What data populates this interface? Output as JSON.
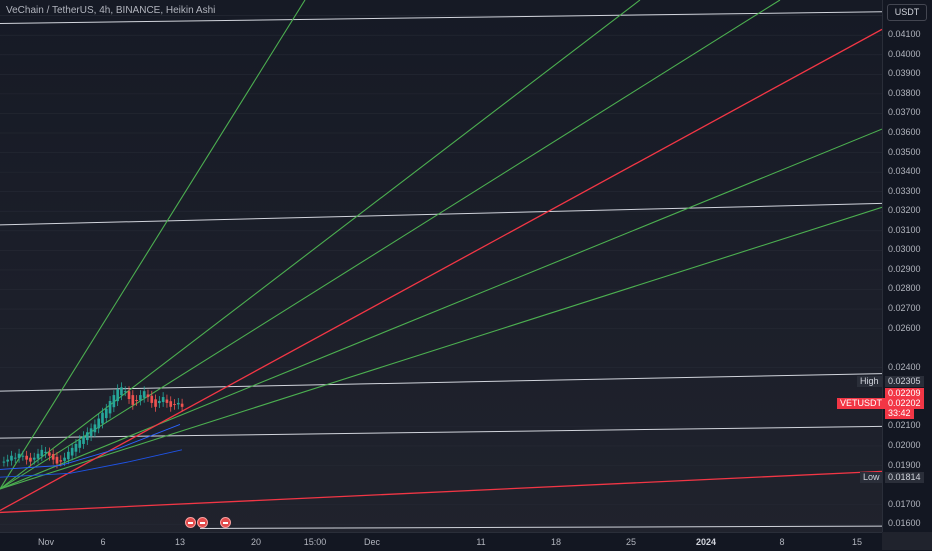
{
  "header": {
    "title": "VeChain / TetherUS, 4h, BINANCE, Heikin Ashi"
  },
  "price_axis": {
    "currency_label": "USDT",
    "tick_labels": [
      "0.04200",
      "0.04100",
      "0.04000",
      "0.03900",
      "0.03800",
      "0.03700",
      "0.03600",
      "0.03500",
      "0.03400",
      "0.03300",
      "0.03200",
      "0.03100",
      "0.03000",
      "0.02900",
      "0.02800",
      "0.02700",
      "0.02600",
      "0.02400",
      "0.02100",
      "0.02000",
      "0.01900",
      "0.01700",
      "0.01600"
    ]
  },
  "price_tags": {
    "high_label": "High",
    "high_value": "0.02305",
    "price_upper": "0.02209",
    "symbol": "VETUSDT",
    "last_price": "0.02202",
    "countdown": "33:42",
    "low_label": "Low",
    "low_value": "0.01814"
  },
  "time_axis": {
    "labels": [
      "Nov",
      "6",
      "13",
      "20",
      "15:00",
      "Dec",
      "11",
      "18",
      "25",
      "2024",
      "8",
      "15"
    ],
    "bold_label": "2024"
  },
  "colors": {
    "background": "#131722",
    "up_candle": "#26a69a",
    "down_candle": "#ef5350",
    "green_line": "#4caf50",
    "red_line": "#f23645",
    "white_line": "#d1d4dc"
  },
  "chart_data": {
    "type": "candlestick",
    "title": "VeChain / TetherUS, 4h, BINANCE, Heikin Ashi",
    "y_scale": "linear",
    "ylim": [
      0.0156,
      0.0428
    ],
    "x_range": [
      "Nov",
      "15"
    ],
    "x_ticks": [
      "Nov",
      "6",
      "13",
      "20",
      "15:00",
      "Dec",
      "11",
      "18",
      "25",
      "2024",
      "8",
      "15"
    ],
    "high": 0.02305,
    "low": 0.01814,
    "last": 0.02202,
    "candles_approx_close": [
      0.0192,
      0.0193,
      0.0195,
      0.0194,
      0.0196,
      0.0195,
      0.0193,
      0.0192,
      0.0194,
      0.0196,
      0.0198,
      0.0197,
      0.0195,
      0.0193,
      0.0191,
      0.0192,
      0.0194,
      0.0197,
      0.0199,
      0.0201,
      0.0203,
      0.0205,
      0.0207,
      0.0209,
      0.0211,
      0.0214,
      0.0217,
      0.0219,
      0.0223,
      0.0226,
      0.0229,
      0.023,
      0.0228,
      0.0224,
      0.0221,
      0.0223,
      0.0226,
      0.0228,
      0.0225,
      0.0222,
      0.022,
      0.0223,
      0.0225,
      0.0222,
      0.022,
      0.0221,
      0.0222,
      0.022
    ],
    "gann_fan_green": [
      {
        "from": [
          0,
          0.0178
        ],
        "to": [
          305,
          0.0428
        ]
      },
      {
        "from": [
          0,
          0.0178
        ],
        "to": [
          640,
          0.0428
        ]
      },
      {
        "from": [
          0,
          0.0178
        ],
        "to": [
          780,
          0.0428
        ]
      },
      {
        "from": [
          0,
          0.0178
        ],
        "to": [
          882,
          0.0362
        ]
      },
      {
        "from": [
          0,
          0.0178
        ],
        "to": [
          882,
          0.0322
        ]
      }
    ],
    "trend_red": [
      {
        "from": [
          0,
          0.0167
        ],
        "to": [
          882,
          0.0413
        ]
      },
      {
        "from": [
          0,
          0.0166
        ],
        "to": [
          882,
          0.0187
        ]
      }
    ],
    "horizontal_white": [
      {
        "from": [
          0,
          0.0416
        ],
        "to": [
          882,
          0.0422
        ]
      },
      {
        "from": [
          0,
          0.0313
        ],
        "to": [
          882,
          0.0324
        ]
      },
      {
        "from": [
          0,
          0.0228
        ],
        "to": [
          882,
          0.0237
        ]
      },
      {
        "from": [
          0,
          0.0204
        ],
        "to": [
          882,
          0.021
        ]
      },
      {
        "from": [
          200,
          0.01578
        ],
        "to": [
          882,
          0.0159
        ]
      }
    ]
  }
}
